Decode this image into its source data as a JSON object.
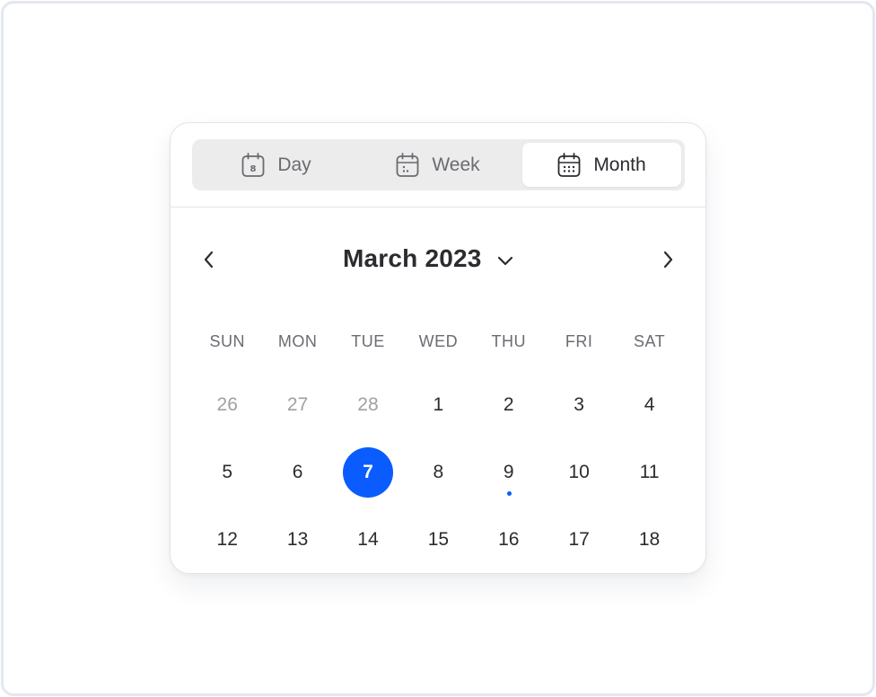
{
  "view_switcher": {
    "day_label": "Day",
    "day_icon_digit": "8",
    "week_label": "Week",
    "month_label": "Month",
    "active": "Month"
  },
  "header": {
    "month_title": "March 2023",
    "prev_icon": "chevron-left-icon",
    "next_icon": "chevron-right-icon",
    "dropdown_icon": "chevron-down-icon"
  },
  "weekdays": [
    "SUN",
    "MON",
    "TUE",
    "WED",
    "THU",
    "FRI",
    "SAT"
  ],
  "weeks": [
    [
      {
        "label": "26",
        "muted": true
      },
      {
        "label": "27",
        "muted": true
      },
      {
        "label": "28",
        "muted": true
      },
      {
        "label": "1"
      },
      {
        "label": "2"
      },
      {
        "label": "3"
      },
      {
        "label": "4"
      }
    ],
    [
      {
        "label": "5"
      },
      {
        "label": "6"
      },
      {
        "label": "7",
        "selected": true
      },
      {
        "label": "8"
      },
      {
        "label": "9",
        "event": true
      },
      {
        "label": "10"
      },
      {
        "label": "11"
      }
    ],
    [
      {
        "label": "12"
      },
      {
        "label": "13"
      },
      {
        "label": "14"
      },
      {
        "label": "15"
      },
      {
        "label": "16"
      },
      {
        "label": "17"
      },
      {
        "label": "18"
      }
    ]
  ],
  "colors": {
    "accent": "#0a5cff",
    "muted_text": "#a0a0a6",
    "text": "#2c2c30"
  }
}
